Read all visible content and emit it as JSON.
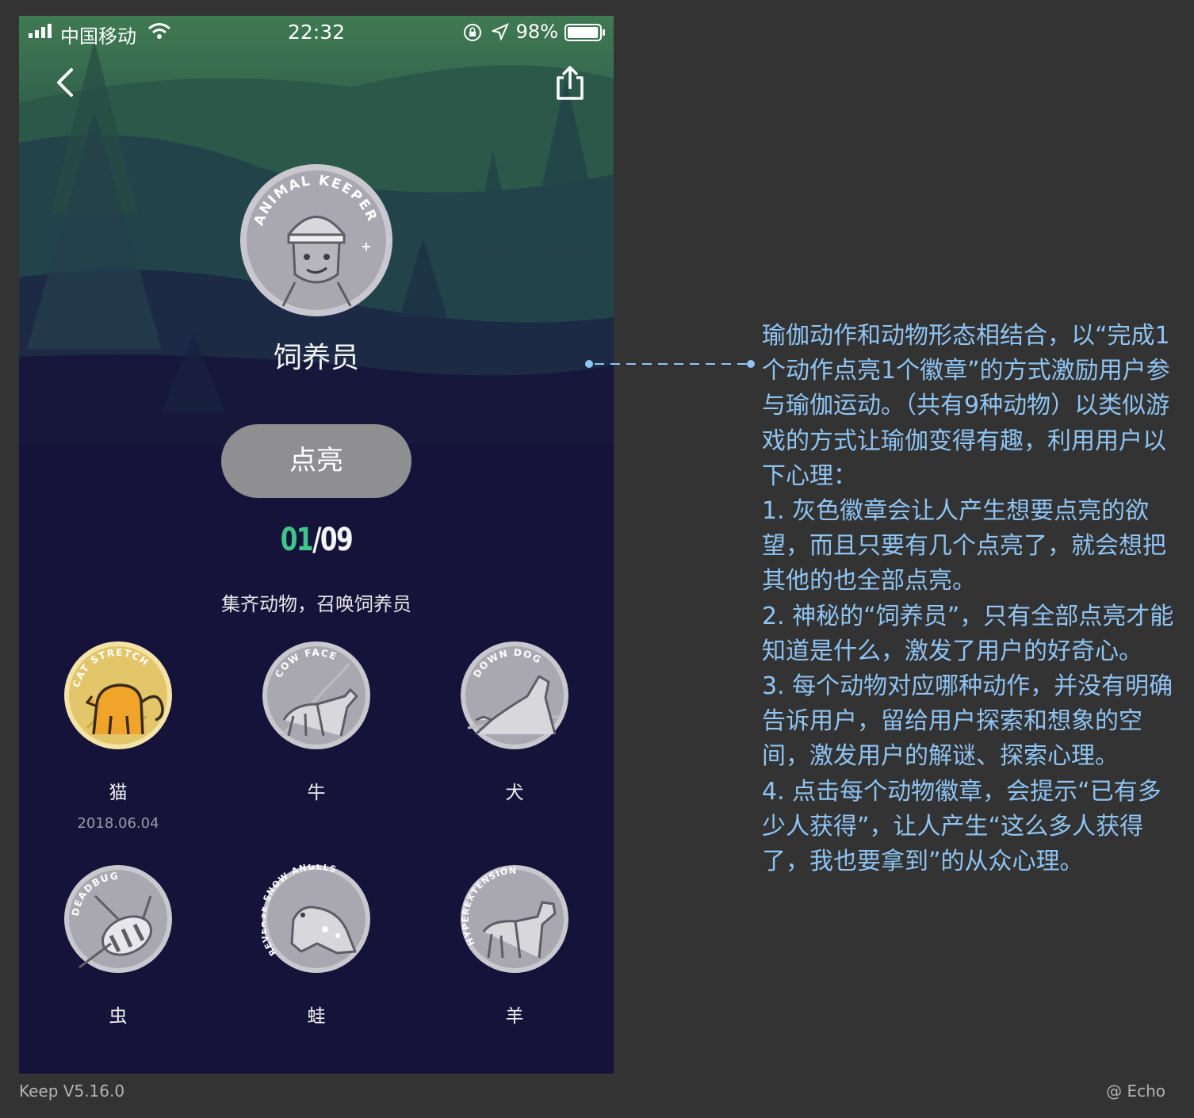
{
  "status_bar": {
    "carrier": "中国移动",
    "time": "22:32",
    "battery": "98%",
    "battery_level": 0.98
  },
  "header": {
    "back_icon": "chevron-left-icon",
    "share_icon": "share-icon"
  },
  "badge": {
    "ring_text": "ANIMAL KEEPER",
    "name": "饲养员"
  },
  "light_button": {
    "label": "点亮"
  },
  "progress": {
    "current": "01",
    "separator": "/",
    "total": "09"
  },
  "subtitle": "集齐动物，召唤饲养员",
  "animals": [
    {
      "name": "猫",
      "date": "2018.06.04",
      "ring_text": "CAT STRETCH",
      "unlocked": true
    },
    {
      "name": "牛",
      "date": "",
      "ring_text": "COW FACE",
      "unlocked": false
    },
    {
      "name": "犬",
      "date": "",
      "ring_text": "DOWN DOG",
      "unlocked": false
    },
    {
      "name": "虫",
      "date": "",
      "ring_text": "DEADBUG",
      "unlocked": false
    },
    {
      "name": "蛙",
      "date": "",
      "ring_text": "REVERSE SNOW ANGELS",
      "unlocked": false
    },
    {
      "name": "羊",
      "date": "",
      "ring_text": "HYPEREXTENSION",
      "unlocked": false
    }
  ],
  "annotation": [
    "瑜伽动作和动物形态相结合，以“完成1个动作点亮1个徽章”的方式激励用户参与瑜伽运动。（共有9种动物）以类似游戏的方式让瑜伽变得有趣，利用用户以下心理：",
    "1. 灰色徽章会让人产生想要点亮的欲望，而且只要有几个点亮了，就会想把其他的也全部点亮。",
    "2. 神秘的“饲养员”，只有全部点亮才能知道是什么，激发了用户的好奇心。",
    "3. 每个动物对应哪种动作，并没有明确告诉用户，留给用户探索和想象的空间，激发用户的解谜、探索心理。",
    "4. 点击每个动物徽章，会提示“已有多少人获得”，让人产生“这么多人获得了，我也要拿到”的从众心理。"
  ],
  "footer": {
    "left": "Keep V5.16.0",
    "right": "@ Echo"
  },
  "colors": {
    "accent_green": "#3fc58a",
    "annotation_blue": "#8fc4f3",
    "badge_gray": "#a9a8b0",
    "badge_gold": "#e3c56a",
    "cat_orange": "#f0a52a",
    "page_bg": "#333333"
  }
}
